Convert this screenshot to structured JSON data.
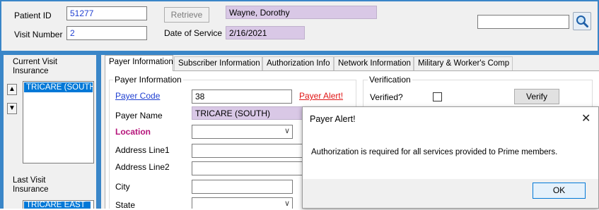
{
  "header": {
    "patient_id_label": "Patient ID",
    "patient_id_value": "51277",
    "retrieve_label": "Retrieve",
    "patient_name": "Wayne, Dorothy",
    "visit_number_label": "Visit Number",
    "visit_number_value": "2",
    "date_of_service_label": "Date of Service",
    "date_of_service_value": "2/16/2021",
    "search_value": ""
  },
  "left_panel": {
    "current_label_1": "Current  Visit",
    "current_label_2": "Insurance",
    "current_items": [
      "TRICARE (SOUTH)"
    ],
    "last_label_1": "Last  Visit",
    "last_label_2": "Insurance",
    "last_items": [
      "TRICARE EAST"
    ]
  },
  "tabs": [
    {
      "label": "Payer Information",
      "active": true
    },
    {
      "label": "Subscriber Information",
      "active": false
    },
    {
      "label": "Authorization Info",
      "active": false
    },
    {
      "label": "Network Information",
      "active": false
    },
    {
      "label": "Military & Worker's Comp",
      "active": false
    }
  ],
  "payer": {
    "group_title": "Payer Information",
    "payer_code_label": "Payer Code",
    "payer_code_value": "38",
    "payer_alert_link": "Payer Alert!",
    "payer_name_label": "Payer Name",
    "payer_name_value": "TRICARE (SOUTH)",
    "location_label": "Location",
    "address1_label": "Address Line1",
    "address2_label": "Address Line2",
    "city_label": "City",
    "state_label": "State"
  },
  "verification": {
    "group_title": "Verification",
    "verified_label": "Verified?",
    "verify_button": "Verify"
  },
  "dialog": {
    "title": "Payer Alert!",
    "message": "Authorization is required for all services provided to Prime members.",
    "ok_label": "OK",
    "close_glyph": "✕"
  },
  "colors": {
    "frame_blue": "#3a86c8",
    "selection_blue": "#0078d7",
    "readonly_lavender": "#d9c8e6",
    "link_blue": "#1f3fd1",
    "alert_red": "#e01414",
    "location_magenta": "#b5147a"
  }
}
